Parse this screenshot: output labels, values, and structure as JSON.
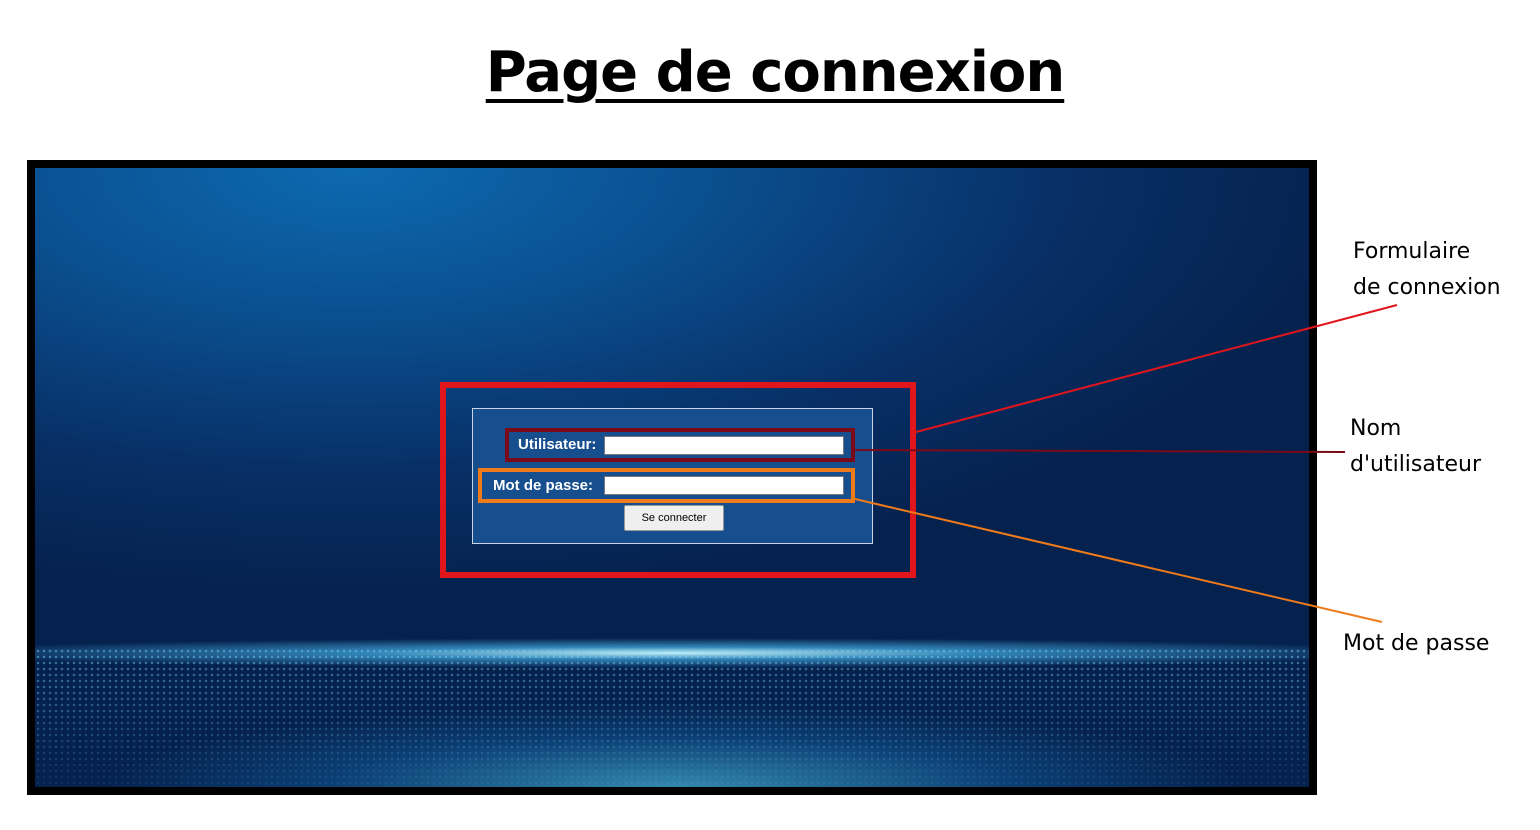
{
  "title": "Page de connexion",
  "login_form": {
    "username_label": "Utilisateur:",
    "username_value": "",
    "password_label": "Mot de passe:",
    "password_value": "",
    "submit_label": "Se connecter"
  },
  "annotations": {
    "form": {
      "line1": "Formulaire",
      "line2": "de connexion",
      "color": "#e0161c"
    },
    "username": {
      "line1": "Nom",
      "line2": "d'utilisateur",
      "color": "#7a0a18"
    },
    "password": {
      "line1": "Mot de passe",
      "color": "#f07b1a"
    }
  },
  "colors": {
    "form_background": "#174f8e",
    "screen_background": "#082f66"
  }
}
